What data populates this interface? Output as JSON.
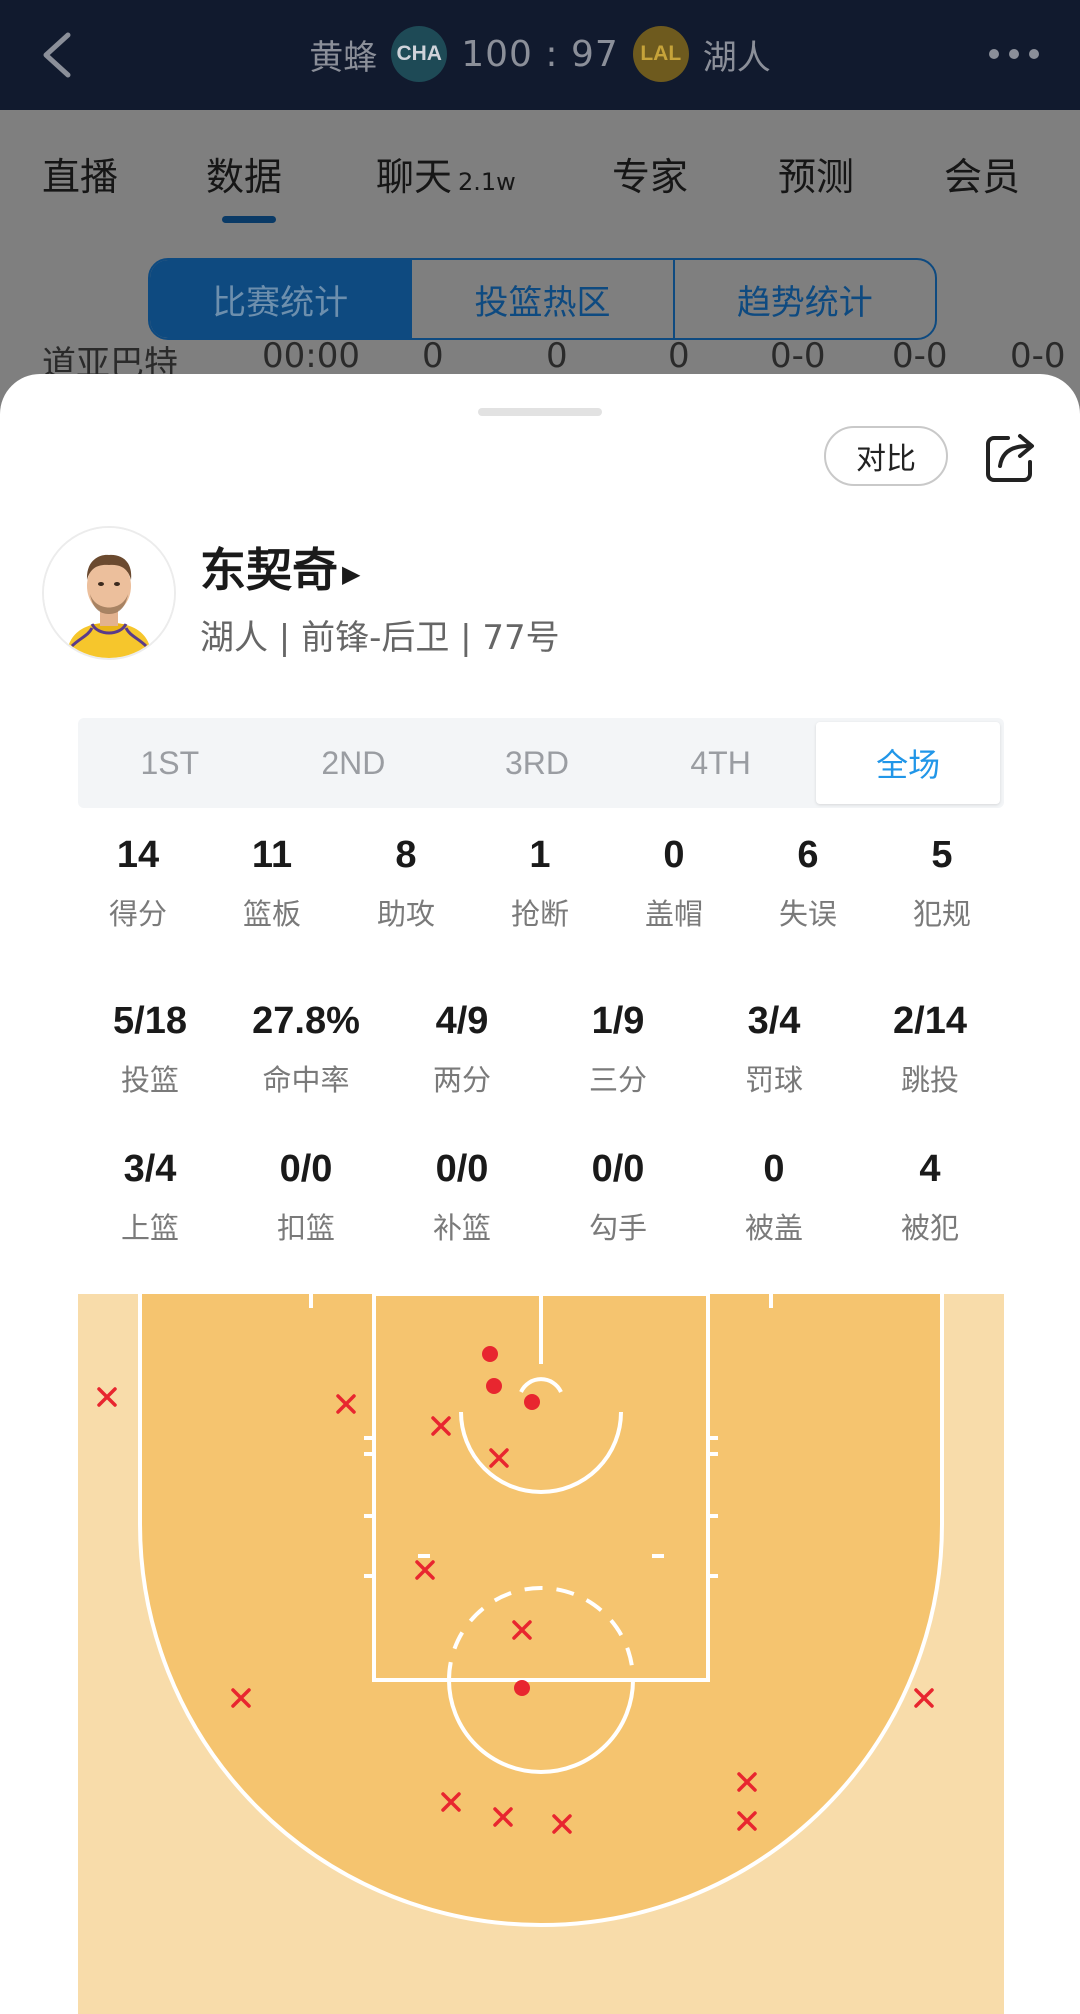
{
  "header": {
    "home_team": "黄蜂",
    "home_logo": "CHA",
    "score": "100 : 97",
    "away_logo": "LAL",
    "away_team": "湖人",
    "icons": {
      "back": "chevron-left-icon",
      "more": "more-dots-icon"
    }
  },
  "tabs": [
    {
      "label": "直播"
    },
    {
      "label": "数据",
      "sub": ""
    },
    {
      "label": "聊天",
      "sub": "2.1w"
    },
    {
      "label": "专家"
    },
    {
      "label": "预测"
    },
    {
      "label": "会员"
    }
  ],
  "segments": [
    "比赛统计",
    "投篮热区",
    "趋势统计"
  ],
  "peek_row": [
    "道亚巴特",
    "00:00",
    "0",
    "0",
    "0",
    "0-0",
    "0-0",
    "0-0"
  ],
  "sheet": {
    "compare_label": "对比",
    "share_icon": "share-icon",
    "player": {
      "name": "东契奇",
      "meta": "湖人 | 前锋-后卫 | 77号",
      "jersey_number": "77"
    },
    "quarters": [
      "1ST",
      "2ND",
      "3RD",
      "4TH",
      "全场"
    ],
    "active_quarter": "全场",
    "stats_row1": [
      {
        "value": "14",
        "label": "得分"
      },
      {
        "value": "11",
        "label": "篮板"
      },
      {
        "value": "8",
        "label": "助攻"
      },
      {
        "value": "1",
        "label": "抢断"
      },
      {
        "value": "0",
        "label": "盖帽"
      },
      {
        "value": "6",
        "label": "失误"
      },
      {
        "value": "5",
        "label": "犯规"
      }
    ],
    "stats_row2": [
      {
        "value": "5/18",
        "label": "投篮"
      },
      {
        "value": "27.8%",
        "label": "命中率"
      },
      {
        "value": "4/9",
        "label": "两分"
      },
      {
        "value": "1/9",
        "label": "三分"
      },
      {
        "value": "3/4",
        "label": "罚球"
      },
      {
        "value": "2/14",
        "label": "跳投"
      }
    ],
    "stats_row3": [
      {
        "value": "3/4",
        "label": "上篮"
      },
      {
        "value": "0/0",
        "label": "扣篮"
      },
      {
        "value": "0/0",
        "label": "补篮"
      },
      {
        "value": "0/0",
        "label": "勾手"
      },
      {
        "value": "0",
        "label": "被盖"
      },
      {
        "value": "4",
        "label": "被犯"
      }
    ],
    "court_colors": {
      "paint": "#f5c46f",
      "outer": "#f8dcaa",
      "line": "#ffffff",
      "made": "#e8262f",
      "missed": "#e8262f"
    }
  }
}
